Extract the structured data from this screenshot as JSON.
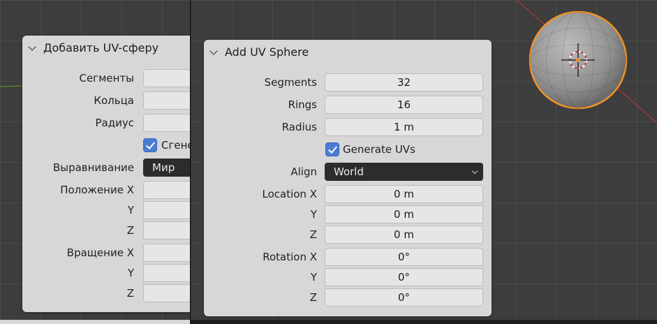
{
  "left_panel": {
    "title": "Добавить UV-сферу",
    "segments_label": "Сегменты",
    "rings_label": "Кольца",
    "radius_label": "Радиус",
    "generate_uvs_label": "Сгене",
    "generate_uvs_checked": true,
    "align_label": "Выравнивание",
    "align_value": "Мир",
    "location_x_label": "Положение X",
    "location_y_label": "Y",
    "location_z_label": "Z",
    "rotation_x_label": "Вращение X",
    "rotation_y_label": "Y",
    "rotation_z_label": "Z"
  },
  "right_panel": {
    "title": "Add UV Sphere",
    "segments_label": "Segments",
    "segments_value": "32",
    "rings_label": "Rings",
    "rings_value": "16",
    "radius_label": "Radius",
    "radius_value": "1 m",
    "generate_uvs_label": "Generate UVs",
    "generate_uvs_checked": true,
    "align_label": "Align",
    "align_value": "World",
    "location_x_label": "Location X",
    "location_x_value": "0 m",
    "location_y_label": "Y",
    "location_y_value": "0 m",
    "location_z_label": "Z",
    "location_z_value": "0 m",
    "rotation_x_label": "Rotation X",
    "rotation_x_value": "0°",
    "rotation_y_label": "Y",
    "rotation_y_value": "0°",
    "rotation_z_label": "Z",
    "rotation_z_value": "0°"
  },
  "colors": {
    "viewport_bg": "#3d3d3d",
    "panel_bg": "#d7d7d7",
    "checkbox_accent": "#4b7bd3",
    "selection_outline": "#f0922a",
    "x_axis": "#b33a3a",
    "y_axis": "#5c8a2a"
  }
}
